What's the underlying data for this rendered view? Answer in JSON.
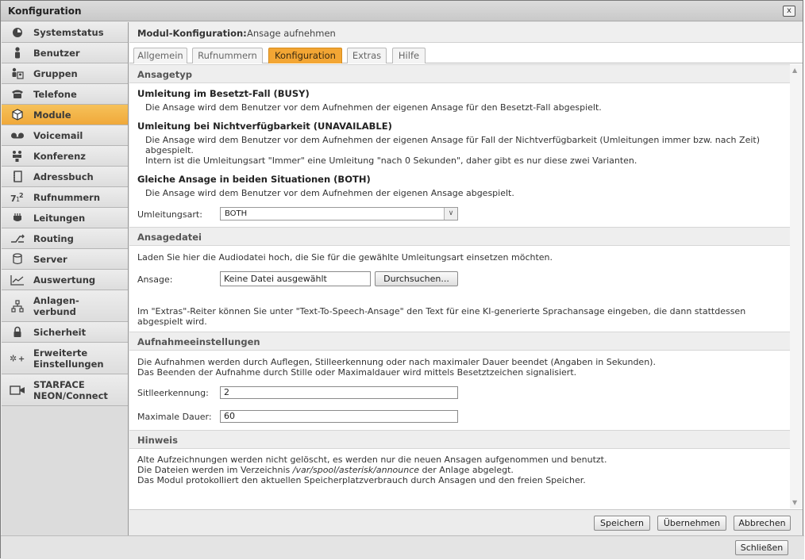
{
  "window": {
    "title": "Konfiguration",
    "close_label": "x"
  },
  "sidebar": {
    "items": [
      {
        "label": "Systemstatus",
        "icon": "gauge-icon"
      },
      {
        "label": "Benutzer",
        "icon": "user-icon"
      },
      {
        "label": "Gruppen",
        "icon": "group-icon"
      },
      {
        "label": "Telefone",
        "icon": "phone-icon"
      },
      {
        "label": "Module",
        "icon": "cube-icon",
        "active": true
      },
      {
        "label": "Voicemail",
        "icon": "voicemail-icon"
      },
      {
        "label": "Konferenz",
        "icon": "conference-icon"
      },
      {
        "label": "Adressbuch",
        "icon": "addressbook-icon"
      },
      {
        "label": "Rufnummern",
        "icon": "numbers-icon"
      },
      {
        "label": "Leitungen",
        "icon": "line-icon"
      },
      {
        "label": "Routing",
        "icon": "routing-icon"
      },
      {
        "label": "Server",
        "icon": "server-icon"
      },
      {
        "label": "Auswertung",
        "icon": "chart-icon"
      },
      {
        "label_line1": "Anlagen-",
        "label_line2": "verbund",
        "icon": "network-icon"
      },
      {
        "label": "Sicherheit",
        "icon": "lock-icon"
      },
      {
        "label_line1": "Erweiterte",
        "label_line2": "Einstellungen",
        "icon": "gears-icon"
      },
      {
        "label_line1": "STARFACE",
        "label_line2": "NEON/Connect",
        "icon": "camera-icon"
      }
    ]
  },
  "header": {
    "title": "Modul-Konfiguration:",
    "subtitle": "Ansage aufnehmen"
  },
  "tabs": [
    {
      "label": "Allgemein"
    },
    {
      "label": "Rufnummern"
    },
    {
      "label": "Konfiguration",
      "active": true
    },
    {
      "label": "Extras"
    },
    {
      "label": "Hilfe"
    }
  ],
  "sections": {
    "ansagetyp": {
      "title": "Ansagetyp",
      "busy_title": "Umleitung im Besetzt-Fall (BUSY)",
      "busy_text": "Die Ansage wird dem Benutzer vor dem Aufnehmen der eigenen Ansage für den Besetzt-Fall abgespielt.",
      "unavail_title": "Umleitung bei Nichtverfügbarkeit (UNAVAILABLE)",
      "unavail_text1": "Die Ansage wird dem Benutzer vor dem Aufnehmen der eigenen Ansage für Fall der Nichtverfügbarkeit (Umleitungen immer bzw. nach Zeit)",
      "unavail_text2": "abgespielt.",
      "unavail_text3": "Intern ist die Umleitungsart \"Immer\" eine Umleitung \"nach 0 Sekunden\", daher gibt es nur diese zwei Varianten.",
      "both_title": "Gleiche Ansage in beiden Situationen (BOTH)",
      "both_text": "Die Ansage wird dem Benutzer vor dem Aufnehmen der eigenen Ansage abgespielt.",
      "field_label": "Umleitungsart:",
      "field_value": "BOTH"
    },
    "ansagedatei": {
      "title": "Ansagedatei",
      "intro": "Laden Sie hier die Audiodatei hoch, die Sie für die gewählte Umleitungsart einsetzen möchten.",
      "field_label": "Ansage:",
      "file_value": "Keine Datei ausgewählt",
      "browse_label": "Durchsuchen...",
      "note1": "Im \"Extras\"-Reiter können Sie unter \"Text-To-Speech-Ansage\" den Text für eine KI-generierte Sprachansage eingeben, die dann stattdessen",
      "note2": "abgespielt wird."
    },
    "aufnahme": {
      "title": "Aufnahmeeinstellungen",
      "text1": "Die Aufnahmen werden durch Auflegen, Stilleerkennung oder nach maximaler Dauer beendet (Angaben in Sekunden).",
      "text2": "Das Beenden der Aufnahme durch Stille oder Maximaldauer wird mittels Besetztzeichen signalisiert.",
      "silence_label": "Sitlleerkennung:",
      "silence_value": "2",
      "maxdur_label": "Maximale Dauer:",
      "maxdur_value": "60"
    },
    "hinweis": {
      "title": "Hinweis",
      "text1": "Alte Aufzeichnungen werden nicht gelöscht, es werden nur die neuen Ansagen aufgenommen und benutzt.",
      "text2_pre": "Die Dateien werden im Verzeichnis ",
      "text2_path": "/var/spool/asterisk/announce",
      "text2_post": " der Anlage abgelegt.",
      "text3": "Das Modul protokolliert den aktuellen Speicherplatzverbrauch durch Ansagen und den freien Speicher."
    }
  },
  "footer": {
    "save": "Speichern",
    "apply": "Übernehmen",
    "cancel": "Abbrechen"
  },
  "bottom": {
    "close": "Schließen"
  },
  "colors": {
    "accent": "#f3a634",
    "active_sidebar": "#f0a93a"
  }
}
